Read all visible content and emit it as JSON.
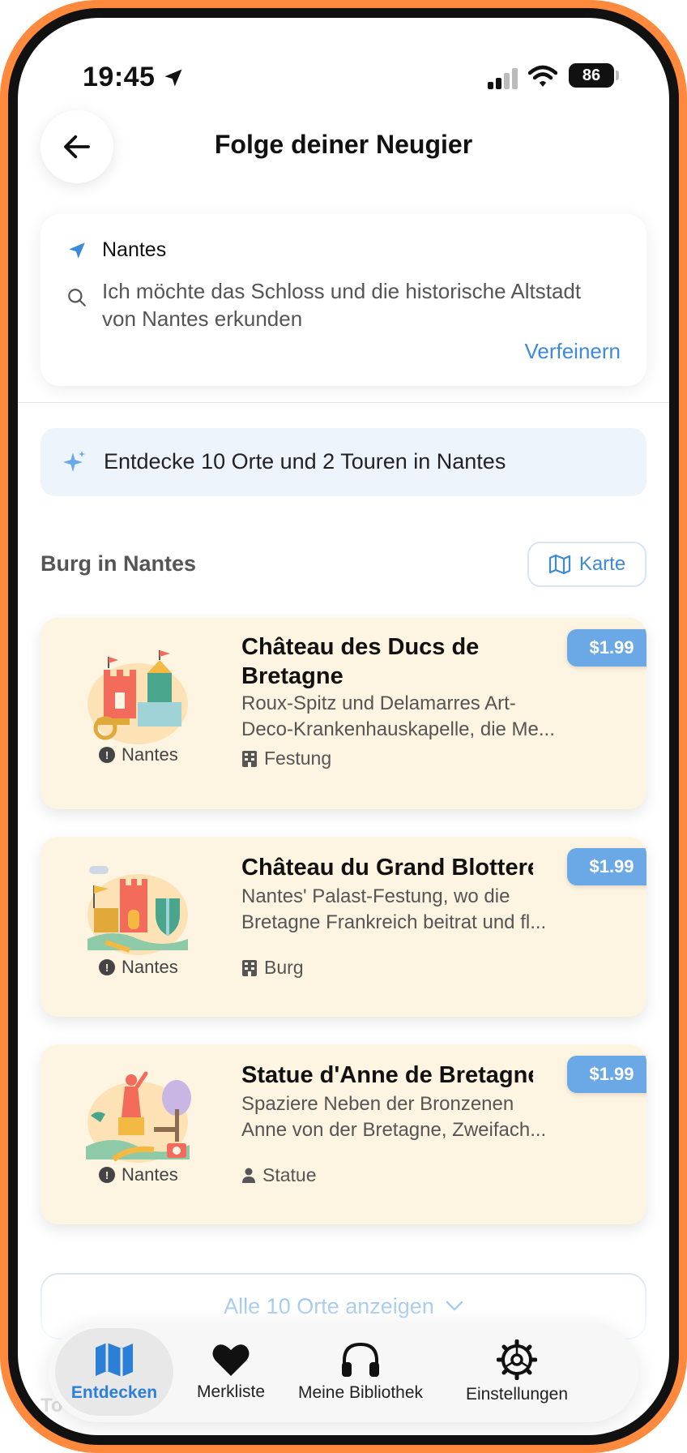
{
  "status_bar": {
    "time": "19:45",
    "battery": "86"
  },
  "header": {
    "title": "Folge deiner Neugier"
  },
  "query": {
    "location": "Nantes",
    "text": "Ich möchte das Schloss und die historische Altstadt von Nantes erkunden",
    "refine_label": "Verfeinern"
  },
  "discover": {
    "text": "Entdecke 10 Orte und 2 Touren in Nantes"
  },
  "section": {
    "title": "Burg in Nantes",
    "map_label": "Karte"
  },
  "places": [
    {
      "name": "Château des Ducs de Bretagne",
      "description_line1": "Roux-Spitz und Delamarres Art-",
      "description_line2": "Deco-Krankenhauskapelle, die Me...",
      "city": "Nantes",
      "category": "Festung",
      "category_icon": "building-icon",
      "price": "$1.99"
    },
    {
      "name": "Château du Grand Blottereau",
      "description_line1": "Nantes' Palast-Festung, wo die",
      "description_line2": "Bretagne Frankreich beitrat und fl...",
      "city": "Nantes",
      "category": "Burg",
      "category_icon": "building-icon",
      "price": "$1.99"
    },
    {
      "name": "Statue d'Anne de Bretagne",
      "description_line1": "Spaziere Neben der Bronzenen",
      "description_line2": "Anne von der Bretagne, Zweifach...",
      "city": "Nantes",
      "category": "Statue",
      "category_icon": "person-icon",
      "price": "$1.99"
    }
  ],
  "show_all_label": "Alle 10 Orte anzeigen",
  "faded_label": "To",
  "tabs": [
    {
      "label": "Entdecken",
      "icon": "map-icon",
      "active": true
    },
    {
      "label": "Merkliste",
      "icon": "heart-icon",
      "active": false
    },
    {
      "label": "Meine Bibliothek",
      "icon": "headphones-icon",
      "active": false
    },
    {
      "label": "Einstellungen",
      "icon": "gear-icon",
      "active": false
    }
  ],
  "colors": {
    "accent": "#3d8ad9",
    "card_bg": "#fdf4e1",
    "price_bg": "#6aa8e6",
    "frame": "#ff8a3d"
  }
}
